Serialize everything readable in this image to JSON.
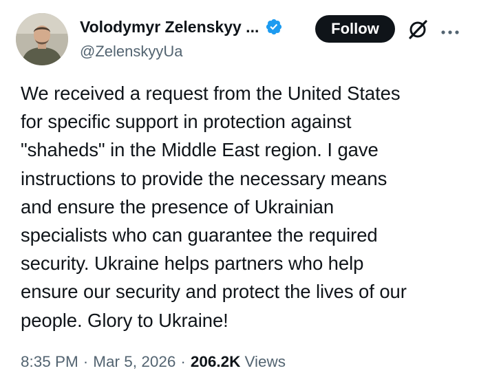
{
  "author": {
    "display_name": "Volodymyr Zelenskyy ...",
    "handle": "@ZelenskyyUa",
    "verified": true,
    "avatar_icon": "profile-photo"
  },
  "actions": {
    "follow_label": "Follow",
    "grok_icon": "grok-icon",
    "more_icon": "more-dots-icon"
  },
  "tweet": {
    "text": "We received a request from the United States\nfor specific support in protection against\n\"shaheds\" in the Middle East region. I gave\ninstructions to provide the necessary means\nand ensure the presence of Ukrainian\nspecialists who can guarantee the required\nsecurity. Ukraine helps partners who help\nensure our security and protect the lives of our\npeople. Glory to Ukraine!"
  },
  "meta": {
    "time": "8:35 PM",
    "separator": "·",
    "date": "Mar 5, 2026",
    "views_count": "206.2K",
    "views_label": "Views"
  },
  "colors": {
    "text_primary": "#0f1419",
    "text_secondary": "#536471",
    "verified_blue": "#1d9bf0",
    "follow_bg": "#0f1419"
  }
}
